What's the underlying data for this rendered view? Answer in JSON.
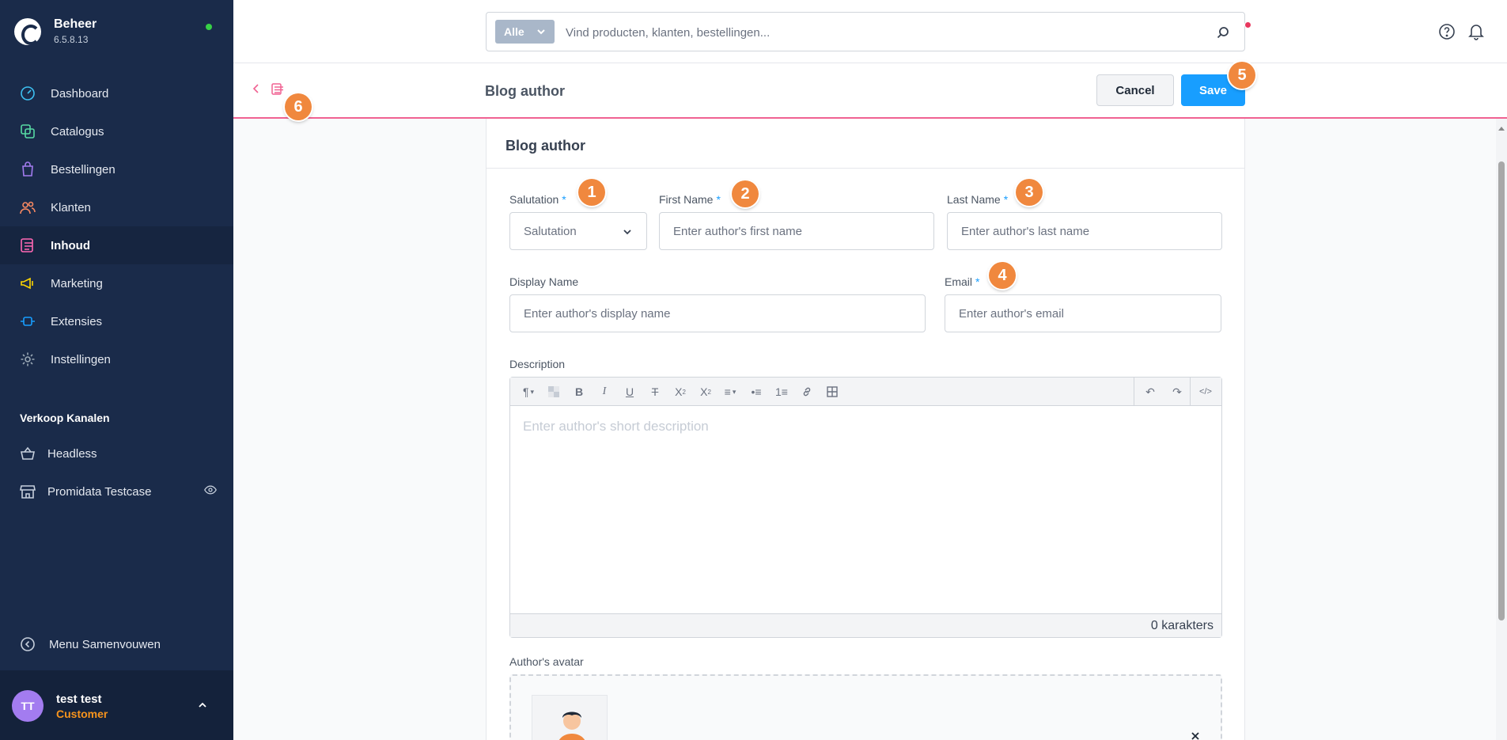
{
  "app": {
    "name": "Beheer",
    "version": "6.5.8.13"
  },
  "sidebar": {
    "items": [
      {
        "label": "Dashboard",
        "icon": "dashboard-gauge-icon",
        "color": "#3dc1f2"
      },
      {
        "label": "Catalogus",
        "icon": "catalogue-icon",
        "color": "#57d9a3"
      },
      {
        "label": "Bestellingen",
        "icon": "shopping-bag-icon",
        "color": "#a37cf0"
      },
      {
        "label": "Klanten",
        "icon": "customers-icon",
        "color": "#f88962"
      },
      {
        "label": "Inhoud",
        "icon": "content-icon",
        "color": "#ff68b4"
      },
      {
        "label": "Marketing",
        "icon": "megaphone-icon",
        "color": "#ffd700"
      },
      {
        "label": "Extensies",
        "icon": "plugin-icon",
        "color": "#189eff"
      },
      {
        "label": "Instellingen",
        "icon": "gear-icon",
        "color": "#9aa8b5"
      }
    ],
    "active_index": 4,
    "sales_channels_title": "Verkoop Kanalen",
    "sales_channels": [
      {
        "label": "Headless",
        "icon": "basket-icon"
      },
      {
        "label": "Promidata Testcase",
        "icon": "storefront-icon"
      }
    ],
    "collapse_label": "Menu Samenvouwen",
    "user": {
      "initials": "TT",
      "name": "test test",
      "role": "Customer"
    }
  },
  "header": {
    "search_type": "Alle",
    "search_placeholder": "Vind producten, klanten, bestellingen..."
  },
  "smartbar": {
    "title": "Blog author",
    "cancel_label": "Cancel",
    "save_label": "Save"
  },
  "card": {
    "title": "Blog author",
    "salutation": {
      "label": "Salutation",
      "placeholder": "Salutation"
    },
    "first_name": {
      "label": "First Name",
      "placeholder": "Enter author's first name"
    },
    "last_name": {
      "label": "Last Name",
      "placeholder": "Enter author's last name"
    },
    "display_name": {
      "label": "Display Name",
      "placeholder": "Enter author's display name"
    },
    "email": {
      "label": "Email",
      "placeholder": "Enter author's email"
    },
    "description": {
      "label": "Description",
      "placeholder": "Enter author's short description",
      "char_count": "0 karakters"
    },
    "avatar": {
      "label": "Author's avatar"
    }
  },
  "badges": [
    "1",
    "2",
    "3",
    "4",
    "5",
    "6"
  ],
  "colors": {
    "accent": "#189eff",
    "badge": "#f0883e",
    "sidebar_bg": "#1a2b4a",
    "smartbar_border": "#f06292"
  }
}
